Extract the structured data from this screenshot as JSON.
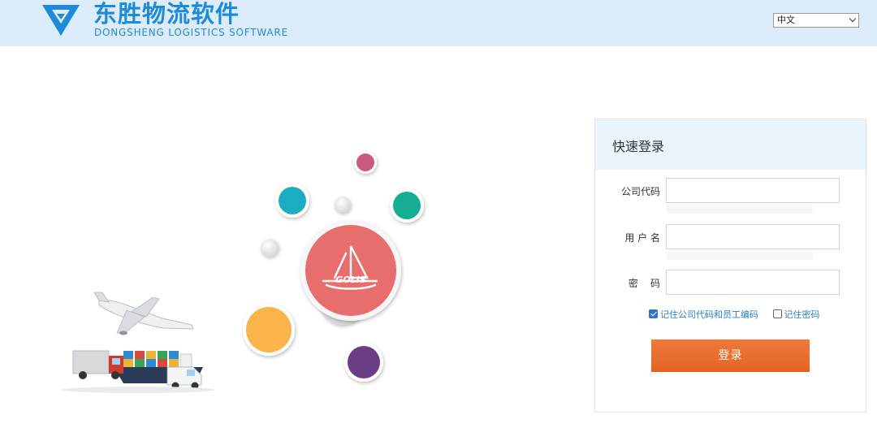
{
  "header": {
    "logo_cn": "东胜物流软件",
    "logo_en": "DONGSHENG LOGISTICS SOFTWARE",
    "language_selected": "中文",
    "brand_color": "#1f8bd8",
    "background": "#dcecfa"
  },
  "login": {
    "title": "快速登录",
    "fields": [
      {
        "label": "公司代码",
        "value": "",
        "placeholder": ""
      },
      {
        "label": "用 户 名",
        "value": "",
        "placeholder": ""
      },
      {
        "label": "密    码",
        "value": "",
        "placeholder": ""
      }
    ],
    "remember_company": {
      "label": "记住公司代码和员工编码",
      "checked": true
    },
    "remember_password": {
      "label": "记住密码",
      "checked": false
    },
    "submit_label": "登录",
    "button_color": "#e96d2e"
  },
  "illustration": {
    "emblem_text": "GOLIS",
    "bubble_colors": [
      "#c95b82",
      "#1aaec0",
      "#15ae93",
      "#fbb44a",
      "#6a3e84",
      "#e86e6e"
    ]
  }
}
